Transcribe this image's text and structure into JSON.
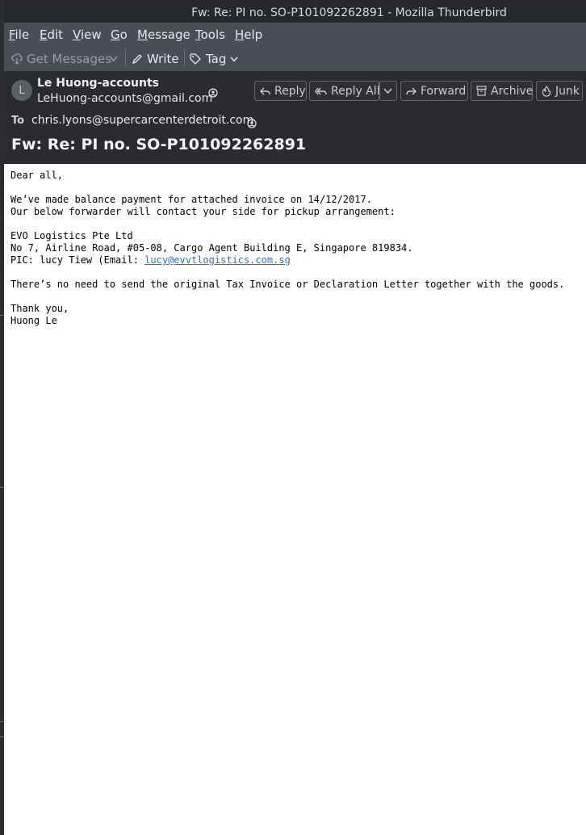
{
  "window": {
    "title": "Fw: Re: PI no. SO-P101092262891 - Mozilla Thunderbird"
  },
  "menu": [
    {
      "label": "File",
      "accel": "F",
      "rest": "ile"
    },
    {
      "label": "Edit",
      "accel": "E",
      "rest": "dit"
    },
    {
      "label": "View",
      "accel": "V",
      "rest": "iew"
    },
    {
      "label": "Go",
      "accel": "G",
      "rest": "o"
    },
    {
      "label": "Message",
      "accel": "M",
      "rest": "essage"
    },
    {
      "label": "Tools",
      "accel": "T",
      "rest": "ools"
    },
    {
      "label": "Help",
      "accel": "H",
      "rest": "elp"
    }
  ],
  "toolbar": {
    "get_messages": "Get Messages",
    "write": "Write",
    "tag": "Tag"
  },
  "message": {
    "avatar_initial": "L",
    "from_name": "Le Huong-accounts",
    "from_email": "LeHuong-accounts@gmail.com",
    "to_label": "To",
    "to_value": "chris.lyons@supercarcenterdetroit.com",
    "subject": "Fw: Re: PI no. SO-P101092262891",
    "actions": {
      "reply": "Reply",
      "reply_all": "Reply All",
      "forward": "Forward",
      "archive": "Archive",
      "junk": "Junk"
    }
  },
  "body": {
    "greeting": "Dear all,",
    "line1": "We’ve made balance payment for attached invoice on 14/12/2017.",
    "line2": "Our below forwarder will contact your side for pickup arrangement:",
    "company": "EVO Logistics Pte Ltd",
    "address": "No 7, Airline Road, #05-08, Cargo Agent Building E, Singapore 819834.",
    "pic_prefix": "PIC: lucy Tiew (Email: ",
    "pic_email": "lucy@evvtlogistics.com.sg",
    "note": "There’s no need to send the original Tax Invoice or Declaration Letter together with the goods.",
    "closing": "Thank you,",
    "signature": "Huong Le"
  },
  "colors": {
    "titlebar": "#26282c",
    "menubar": "#4a4d54",
    "header": "#2a2b2f",
    "link": "#2f6fd1"
  }
}
